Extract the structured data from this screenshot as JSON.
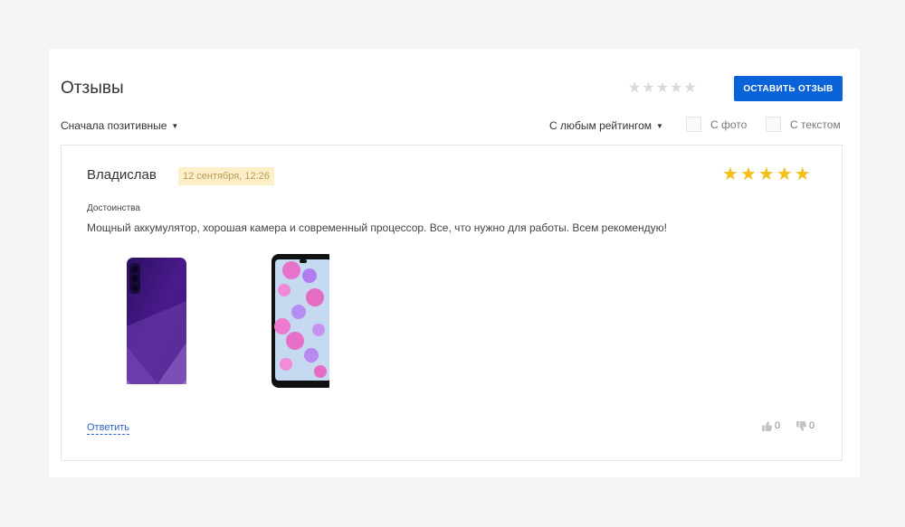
{
  "section": {
    "title": "Отзывы",
    "leave_review_label": "ОСТАВИТЬ ОТЗЫВ",
    "average_rating": 0,
    "max_rating": 5
  },
  "filters": {
    "sort_label": "Сначала позитивные",
    "rating_label": "С любым рейтингом",
    "with_photo_label": "С фото",
    "with_text_label": "С текстом"
  },
  "review": {
    "author": "Владислав",
    "date": "12 сентября, 12:26",
    "rating": 5,
    "pros_label": "Достоинства",
    "text": "Мощный аккумулятор, хорошая камера и современный процессор. Все, что нужно для работы. Всем рекомендую!",
    "reply_label": "Ответить",
    "likes": "0",
    "dislikes": "0"
  },
  "colors": {
    "accent": "#0a62d8",
    "star_filled": "#f2c018",
    "star_empty": "#d9d9d9",
    "date_bg": "#fdf0c9"
  }
}
